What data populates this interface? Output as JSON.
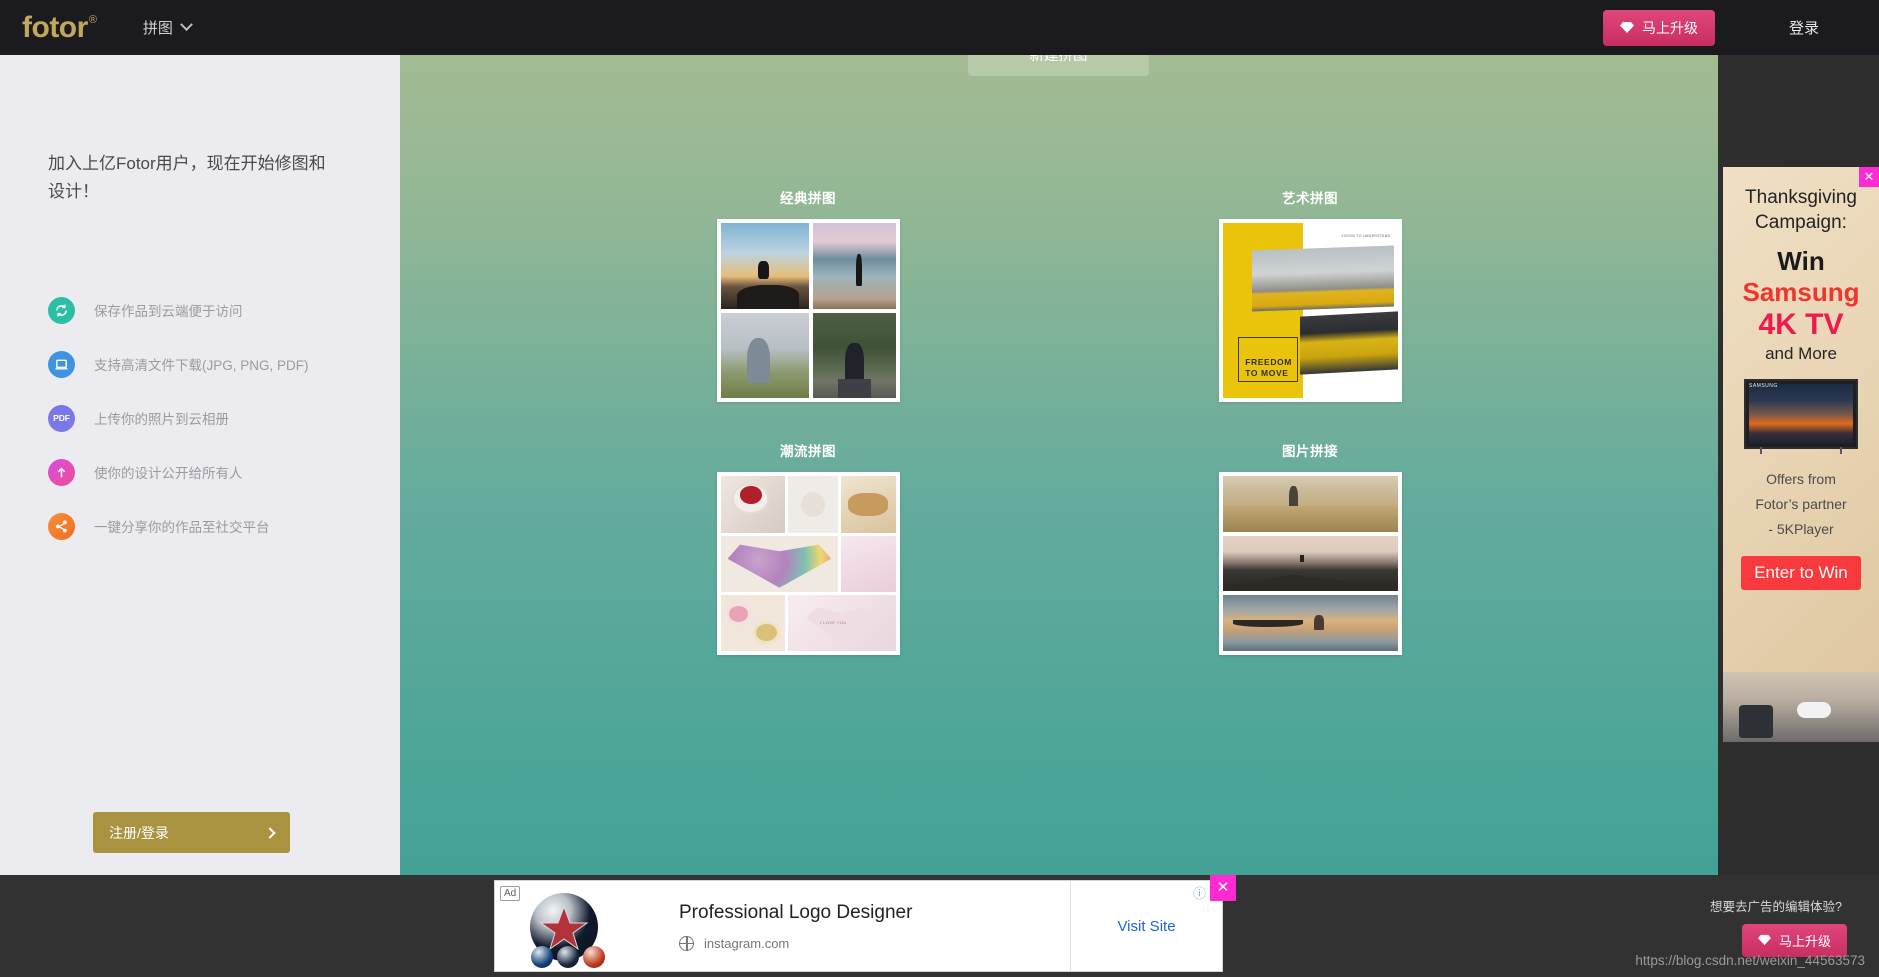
{
  "header": {
    "logo": "fotor",
    "logo_reg": "®",
    "nav_label": "拼图",
    "upgrade_label": "马上升级",
    "login_label": "登录"
  },
  "sidebar": {
    "title": "加入上亿Fotor用户，现在开始修图和设计！",
    "features": [
      {
        "icon": "sync-cloud-icon",
        "label": "保存作品到云端便于访问",
        "color": "#2bbfa4"
      },
      {
        "icon": "download-monitor-icon",
        "label": "支持高清文件下载(JPG, PNG, PDF)",
        "color": "#3f93e0"
      },
      {
        "icon": "pdf-icon",
        "label": "上传你的照片到云相册",
        "color": "#7a77e8"
      },
      {
        "icon": "upload-arrow-icon",
        "label": "使你的设计公开给所有人",
        "color": "#e052b4"
      },
      {
        "icon": "share-icon",
        "label": "一键分享你的作品至社交平台",
        "color": "#f47c28"
      }
    ],
    "signup_label": "注册/登录"
  },
  "main": {
    "new_collage_label": "新建拼图",
    "templates": [
      {
        "title": "经典拼图",
        "thumb": "classic-grid-thumb"
      },
      {
        "title": "艺术拼图",
        "thumb": "art-collage-thumb"
      },
      {
        "title": "潮流拼图",
        "thumb": "trendy-collage-thumb"
      },
      {
        "title": "图片拼接",
        "thumb": "photo-stitch-thumb"
      }
    ],
    "art_thumb_text": {
      "caption": "VISION TO UNDERSTAND",
      "headline_line1": "FREEDOM",
      "headline_line2": "TO MOVE"
    }
  },
  "right_ad": {
    "close_label": "✕",
    "heading_line1": "Thanksgiving",
    "heading_line2": "Campaign:",
    "win": "Win",
    "brand": "Samsung",
    "product": "4K TV",
    "and_more": "and More",
    "tv_brand": "SAMSUNG",
    "offers_line1": "Offers from",
    "offers_line2": "Fotor’s partner",
    "offers_line3": "- 5KPlayer",
    "cta": "Enter to Win",
    "cta_color": "#f8393e",
    "brand_color": "#f0352c",
    "product_color": "#f01a4d"
  },
  "bottom_ad": {
    "badge": "Ad",
    "title": "Professional Logo Designer",
    "url": "instagram.com",
    "visit_label": "Visit Site",
    "close_label": "✕",
    "info_mark": "ⓘ"
  },
  "bottom_right": {
    "prompt": "想要去广告的编辑体验?",
    "upgrade_label": "马上升级",
    "watermark": "https://blog.csdn.net/weixin_44563573"
  }
}
